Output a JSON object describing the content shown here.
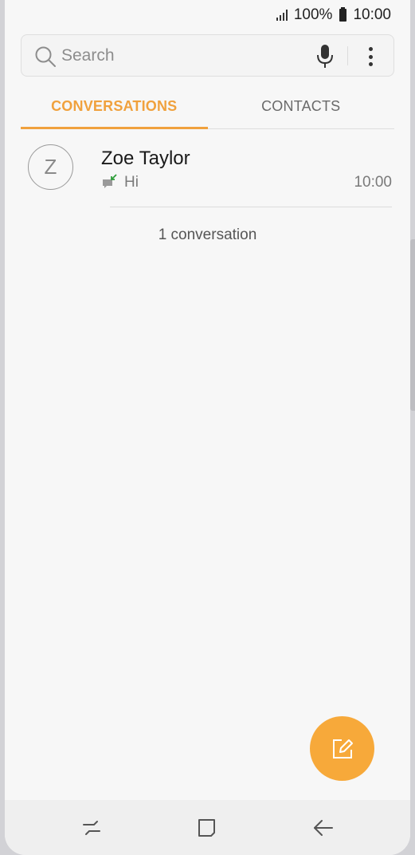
{
  "status_bar": {
    "battery": "100%",
    "time": "10:00",
    "icons": [
      "signal-icon",
      "battery-icon"
    ]
  },
  "search": {
    "placeholder": "Search",
    "value": "",
    "icons": [
      "search-icon",
      "mic-icon",
      "more-options-icon"
    ]
  },
  "tabs": [
    {
      "label": "CONVERSATIONS",
      "active": true
    },
    {
      "label": "CONTACTS",
      "active": false
    }
  ],
  "conversations": [
    {
      "avatar_letter": "Z",
      "name": "Zoe Taylor",
      "preview": "Hi",
      "time": "10:00",
      "status_icon": "received-message-icon"
    }
  ],
  "conversation_count": "1 conversation",
  "fab": {
    "icon": "compose-icon"
  },
  "nav_bar": {
    "icons": [
      "recents-icon",
      "home-icon",
      "back-icon"
    ]
  },
  "colors": {
    "accent": "#f0a13d",
    "fab": "#f7a93a",
    "received_arrow": "#2e9e3a",
    "background": "#f7f7f7"
  }
}
